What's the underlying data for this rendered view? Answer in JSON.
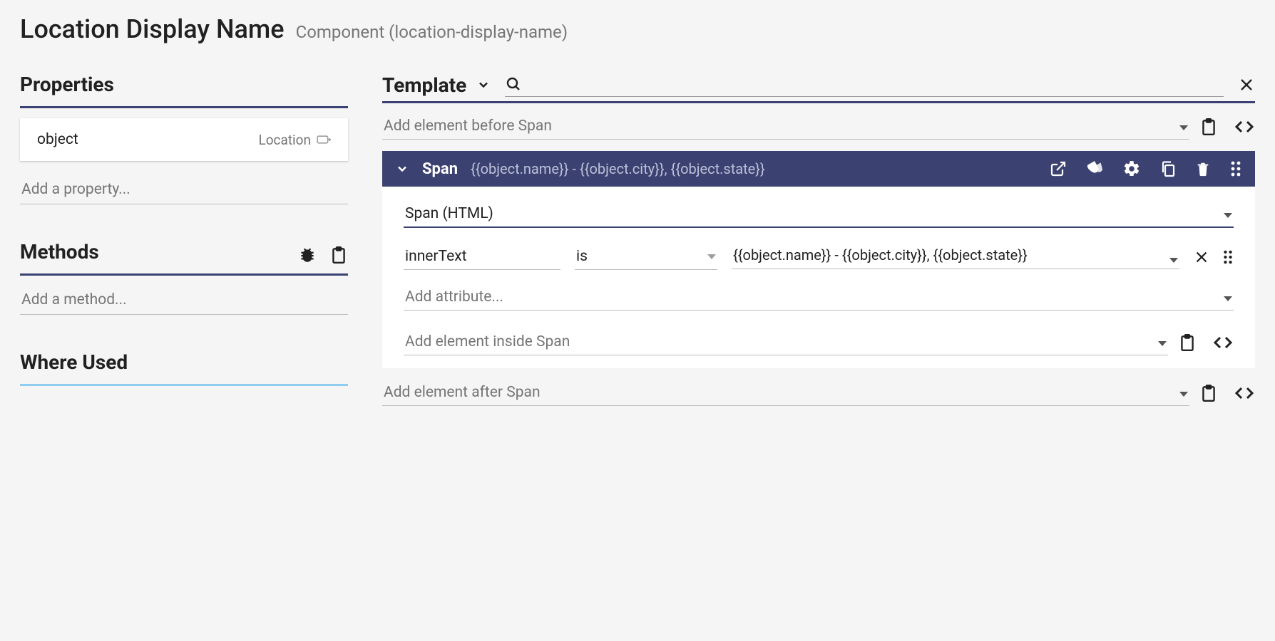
{
  "header": {
    "title": "Location Display Name",
    "subtitle": "Component (location-display-name)"
  },
  "left": {
    "properties": {
      "title": "Properties",
      "items": [
        {
          "name": "object",
          "type": "Location"
        }
      ],
      "add_placeholder": "Add a property..."
    },
    "methods": {
      "title": "Methods",
      "add_placeholder": "Add a method..."
    },
    "where_used": {
      "title": "Where Used"
    }
  },
  "right": {
    "template": {
      "title": "Template",
      "add_before": "Add element before Span",
      "span": {
        "label": "Span",
        "expression": "{{object.name}} - {{object.city}}, {{object.state}}",
        "type_select": "Span (HTML)",
        "attr_name": "innerText",
        "attr_op": "is",
        "attr_value": "{{object.name}} - {{object.city}}, {{object.state}}",
        "add_attribute": "Add attribute...",
        "add_inside": "Add element inside Span"
      },
      "add_after": "Add element after Span"
    }
  }
}
